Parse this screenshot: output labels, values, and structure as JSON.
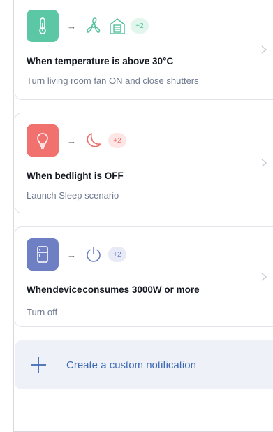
{
  "notifications": [
    {
      "tile_color": "#5cc7a4",
      "trigger_icon": "thermometer-icon",
      "action_icons": [
        "fan-icon",
        "shutter-house-icon"
      ],
      "action_color": "#52c19c",
      "badge": "+2",
      "badge_bg": "#e3f6ee",
      "badge_color": "#52c19c",
      "title": "When temperature is above 30°C",
      "subtitle": "Turn living room fan ON and close shutters"
    },
    {
      "tile_color": "#f0716e",
      "trigger_icon": "lightbulb-icon",
      "action_icons": [
        "moon-icon"
      ],
      "action_color": "#ef6d68",
      "badge": "+2",
      "badge_bg": "#fde6e5",
      "badge_color": "#ef6d68",
      "title": "When bedlight is OFF",
      "subtitle": "Launch Sleep scenario"
    },
    {
      "tile_color": "#6f7fc3",
      "trigger_icon": "fridge-icon",
      "action_icons": [
        "power-icon"
      ],
      "action_color": "#6f7fc3",
      "badge": "+2",
      "badge_bg": "#e8eaf6",
      "badge_color": "#6f7fc3",
      "title_prefix": "When",
      "title_bold": "device",
      "title_suffix": "consumes 3000W or more",
      "subtitle": "Turn off"
    }
  ],
  "arrow": "→",
  "create": {
    "label": "Create a custom notification",
    "icon": "plus-icon",
    "color": "#3d68b3"
  }
}
